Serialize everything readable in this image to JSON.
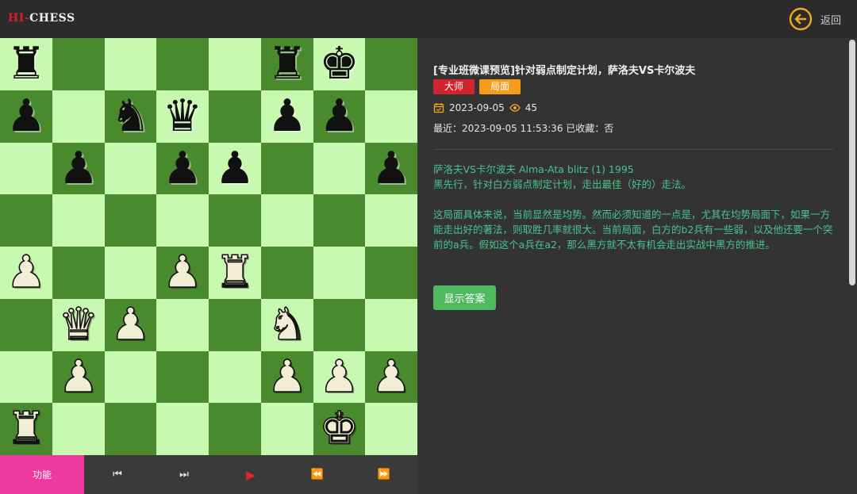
{
  "app": {
    "logo_part1": "HI-",
    "logo_part2": "CHESS",
    "back_label": "返回"
  },
  "board": {
    "squares": [
      {
        "r": 0,
        "c": 0,
        "p": "♜",
        "s": "b"
      },
      {
        "r": 0,
        "c": 5,
        "p": "♜",
        "s": "b"
      },
      {
        "r": 0,
        "c": 6,
        "p": "♚",
        "s": "b"
      },
      {
        "r": 1,
        "c": 0,
        "p": "♟",
        "s": "b"
      },
      {
        "r": 1,
        "c": 2,
        "p": "♞",
        "s": "b"
      },
      {
        "r": 1,
        "c": 3,
        "p": "♛",
        "s": "b"
      },
      {
        "r": 1,
        "c": 5,
        "p": "♟",
        "s": "b"
      },
      {
        "r": 1,
        "c": 6,
        "p": "♟",
        "s": "b"
      },
      {
        "r": 2,
        "c": 1,
        "p": "♟",
        "s": "b"
      },
      {
        "r": 2,
        "c": 3,
        "p": "♟",
        "s": "b"
      },
      {
        "r": 2,
        "c": 4,
        "p": "♟",
        "s": "b"
      },
      {
        "r": 2,
        "c": 7,
        "p": "♟",
        "s": "b"
      },
      {
        "r": 4,
        "c": 0,
        "p": "♟",
        "s": "w"
      },
      {
        "r": 4,
        "c": 3,
        "p": "♟",
        "s": "w"
      },
      {
        "r": 4,
        "c": 4,
        "p": "♜",
        "s": "w"
      },
      {
        "r": 5,
        "c": 1,
        "p": "♛",
        "s": "w"
      },
      {
        "r": 5,
        "c": 2,
        "p": "♟",
        "s": "w"
      },
      {
        "r": 5,
        "c": 5,
        "p": "♞",
        "s": "w"
      },
      {
        "r": 6,
        "c": 1,
        "p": "♟",
        "s": "w"
      },
      {
        "r": 6,
        "c": 5,
        "p": "♟",
        "s": "w"
      },
      {
        "r": 6,
        "c": 6,
        "p": "♟",
        "s": "w"
      },
      {
        "r": 6,
        "c": 7,
        "p": "♟",
        "s": "w"
      },
      {
        "r": 7,
        "c": 0,
        "p": "♜",
        "s": "w"
      },
      {
        "r": 7,
        "c": 6,
        "p": "♚",
        "s": "w"
      }
    ]
  },
  "controls": {
    "function_label": "功能",
    "first_icon": "⏮",
    "last_icon": "⏭",
    "play_icon": "▶",
    "prev_icon": "⏪",
    "next_icon": "⏩"
  },
  "panel": {
    "title": "[专业班微课预览]针对弱点制定计划，萨洛夫VS卡尔波夫",
    "tags": [
      "大师",
      "局面"
    ],
    "date": "2023-09-05",
    "views": "45",
    "recent": "最近：2023-09-05 11:53:36 已收藏：否",
    "description_lines": [
      "萨洛夫VS卡尔波夫 Alma-Ata blitz (1) 1995",
      "黑先行，针对白方弱点制定计划，走出最佳（好的）走法。",
      "这局面具体来说，当前显然是均势。然而必须知道的一点是，尤其在均势局面下，如果一方能走出好的著法，则取胜几率就很大。当前局面，白方的b2兵有一些弱，以及他还要一个突前的a兵。假如这个a兵在a2，那么黑方就不太有机会走出实战中黑方的推进。"
    ],
    "answer_button": "显示答案"
  },
  "colors": {
    "light_square": "#c8f9b0",
    "dark_square": "#4a8a2e",
    "accent_pink": "#ee3aa0",
    "tag_red": "#d2242f",
    "tag_orange": "#f59b1a",
    "text_green": "#48c48f",
    "button_green": "#4fba60"
  }
}
